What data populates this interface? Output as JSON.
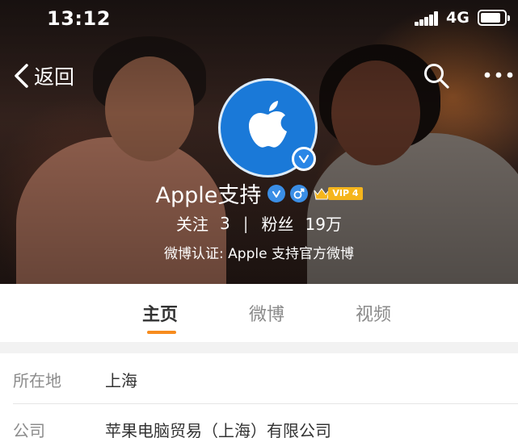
{
  "status_bar": {
    "time": "13:12",
    "network": "4G",
    "battery_level": 0.85
  },
  "nav": {
    "back_label": "返回",
    "back_icon": "chevron-left-icon",
    "search_icon": "search-icon",
    "more_icon": "more-dots-icon"
  },
  "profile": {
    "name": "Apple支持",
    "avatar_icon": "apple-logo-icon",
    "avatar_color": "#1a79d8",
    "verified_icon": "verified-icon",
    "gender_icon": "male-icon",
    "vip_label": "VIP 4",
    "vip_color": "#f5b51c",
    "following_label": "关注",
    "following_count": "3",
    "followers_label": "粉丝",
    "followers_count": "19万",
    "stat_separator": "|",
    "verification_text": "微博认证: Apple 支持官方微博"
  },
  "tabs": [
    {
      "label": "主页",
      "active": true
    },
    {
      "label": "微博",
      "active": false
    },
    {
      "label": "视频",
      "active": false
    }
  ],
  "accent_color": "#f78c1e",
  "info": [
    {
      "key": "所在地",
      "value": "上海"
    },
    {
      "key": "公司",
      "value": "苹果电脑贸易（上海）有限公司"
    }
  ]
}
